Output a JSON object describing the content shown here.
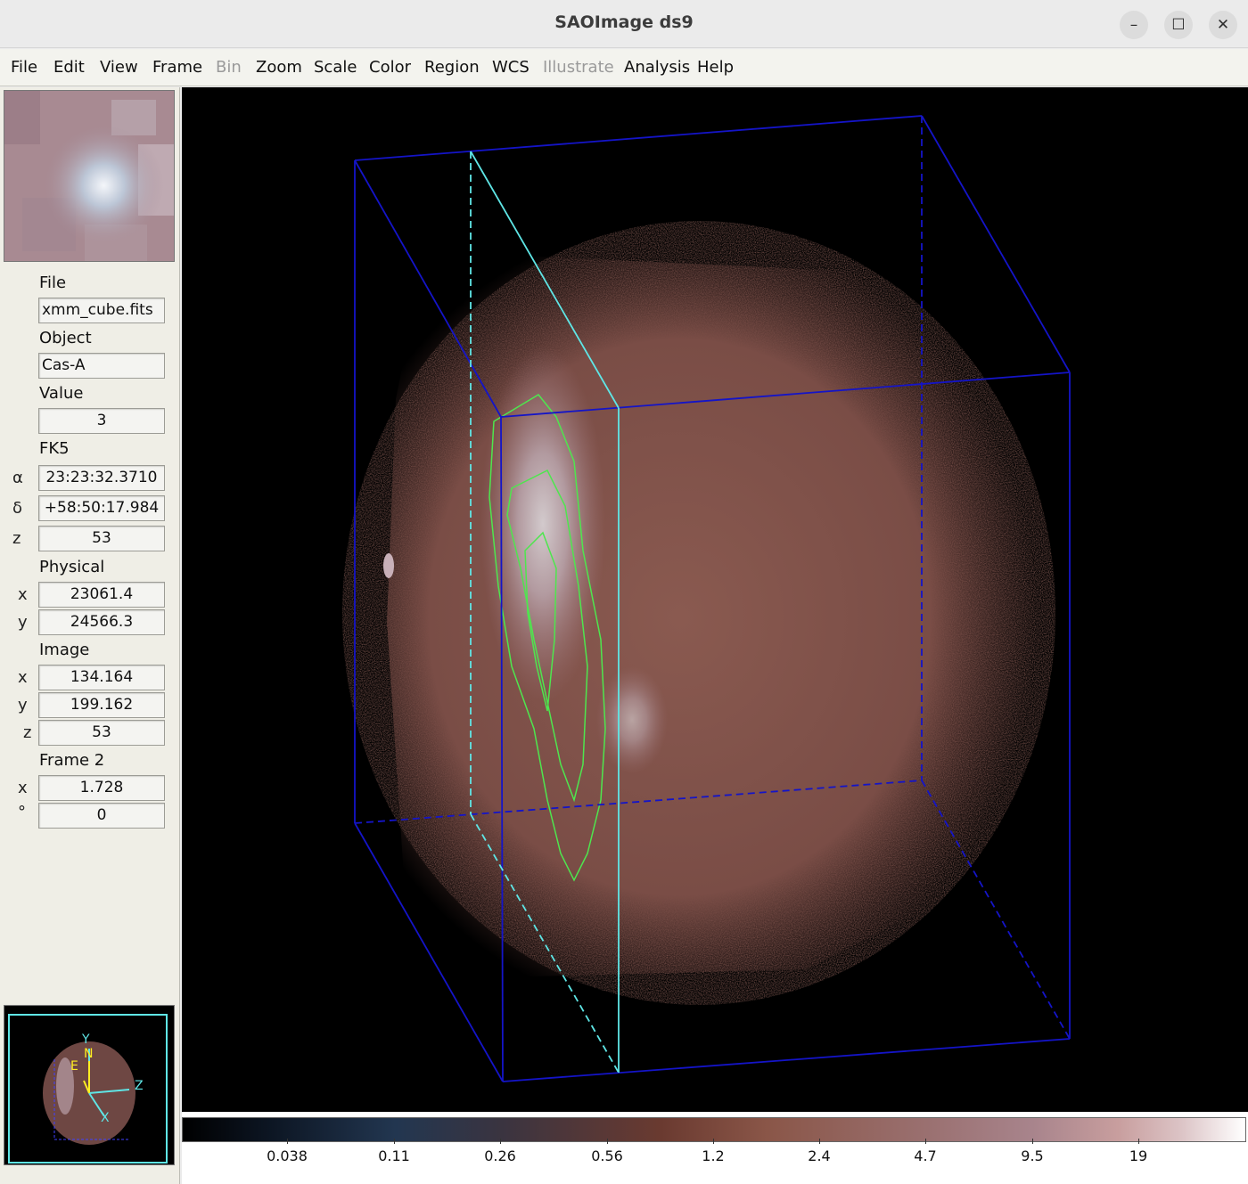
{
  "window": {
    "title": "SAOImage ds9",
    "minimize_glyph": "–",
    "maximize_glyph": "☐",
    "close_glyph": "✕"
  },
  "menu": [
    "File",
    "Edit",
    "View",
    "Frame",
    "Bin",
    "Zoom",
    "Scale",
    "Color",
    "Region",
    "WCS",
    "Illustrate",
    "Analysis",
    "Help"
  ],
  "menu_disabled": [
    "Bin",
    "Illustrate"
  ],
  "info": {
    "file_label": "File",
    "file_value": "xmm_cube.fits",
    "object_label": "Object",
    "object_value": "Cas-A",
    "value_label": "Value",
    "value_value": "3",
    "wcs_label": "FK5",
    "alpha_label": "α",
    "alpha_value": "23:23:32.3710",
    "delta_label": "δ",
    "delta_value": "+58:50:17.984",
    "z_label": "z",
    "wcs_z_value": "53",
    "physical_label": "Physical",
    "phys_x_label": "x",
    "phys_x_value": "23061.4",
    "phys_y_label": "y",
    "phys_y_value": "24566.3",
    "image_label": "Image",
    "img_x_label": "x",
    "img_x_value": "134.164",
    "img_y_label": "y",
    "img_y_value": "199.162",
    "img_z_label": "z",
    "img_z_value": "53",
    "frame_label": "Frame 2",
    "frame_x_label": "x",
    "frame_x_value": "1.728",
    "frame_deg_label": "°",
    "frame_deg_value": "0"
  },
  "magnifier": {
    "y_axis": "Y",
    "z_axis": "Z",
    "x_axis": "X",
    "north": "N",
    "east": "E"
  },
  "colorbar": {
    "ticks": [
      "0.038",
      "0.11",
      "0.26",
      "0.56",
      "1.2",
      "2.4",
      "4.7",
      "9.5",
      "19"
    ],
    "colors": {
      "low": "#000000",
      "mid": "#8a5648",
      "high": "#ffffff"
    }
  },
  "colors": {
    "cube_frame": "#1414c8",
    "slice_plane": "#5fe6e6",
    "contour": "#4ee64e",
    "emission": "#8a5a50"
  }
}
